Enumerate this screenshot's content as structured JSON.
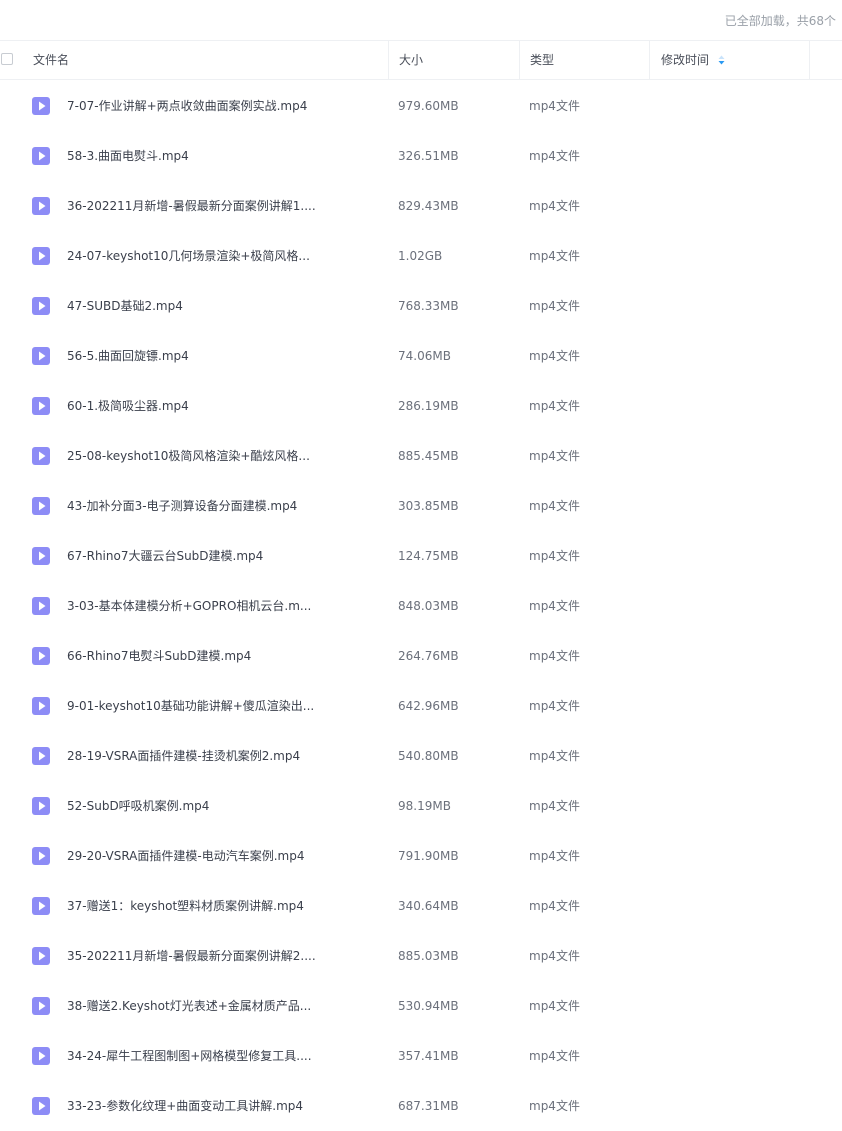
{
  "status": "已全部加载，共68个",
  "header": {
    "name": "文件名",
    "size": "大小",
    "type": "类型",
    "modified": "修改时间"
  },
  "colors": {
    "icon": "#8d8cf6",
    "sort": "#2b9af3"
  },
  "files": [
    {
      "name": "7-07-作业讲解+两点收敛曲面案例实战.mp4",
      "size": "979.60MB",
      "type": "mp4文件"
    },
    {
      "name": "58-3.曲面电熨斗.mp4",
      "size": "326.51MB",
      "type": "mp4文件"
    },
    {
      "name": "36-202211月新增-暑假最新分面案例讲解1....",
      "size": "829.43MB",
      "type": "mp4文件"
    },
    {
      "name": "24-07-keyshot10几何场景渲染+极简风格...",
      "size": "1.02GB",
      "type": "mp4文件"
    },
    {
      "name": "47-SUBD基础2.mp4",
      "size": "768.33MB",
      "type": "mp4文件"
    },
    {
      "name": "56-5.曲面回旋镖.mp4",
      "size": "74.06MB",
      "type": "mp4文件"
    },
    {
      "name": "60-1.极简吸尘器.mp4",
      "size": "286.19MB",
      "type": "mp4文件"
    },
    {
      "name": "25-08-keyshot10极简风格渲染+酷炫风格...",
      "size": "885.45MB",
      "type": "mp4文件"
    },
    {
      "name": "43-加补分面3-电子测算设备分面建模.mp4",
      "size": "303.85MB",
      "type": "mp4文件"
    },
    {
      "name": "67-Rhino7大疆云台SubD建模.mp4",
      "size": "124.75MB",
      "type": "mp4文件"
    },
    {
      "name": "3-03-基本体建模分析+GOPRO相机云台.m...",
      "size": "848.03MB",
      "type": "mp4文件"
    },
    {
      "name": "66-Rhino7电熨斗SubD建模.mp4",
      "size": "264.76MB",
      "type": "mp4文件"
    },
    {
      "name": "9-01-keyshot10基础功能讲解+傻瓜渲染出...",
      "size": "642.96MB",
      "type": "mp4文件"
    },
    {
      "name": "28-19-VSRA面插件建模-挂烫机案例2.mp4",
      "size": "540.80MB",
      "type": "mp4文件"
    },
    {
      "name": "52-SubD呼吸机案例.mp4",
      "size": "98.19MB",
      "type": "mp4文件"
    },
    {
      "name": "29-20-VSRA面插件建模-电动汽车案例.mp4",
      "size": "791.90MB",
      "type": "mp4文件"
    },
    {
      "name": "37-赠送1：keyshot塑料材质案例讲解.mp4",
      "size": "340.64MB",
      "type": "mp4文件"
    },
    {
      "name": "35-202211月新增-暑假最新分面案例讲解2....",
      "size": "885.03MB",
      "type": "mp4文件"
    },
    {
      "name": "38-赠送2.Keyshot灯光表述+金属材质产品...",
      "size": "530.94MB",
      "type": "mp4文件"
    },
    {
      "name": "34-24-犀牛工程图制图+网格模型修复工具....",
      "size": "357.41MB",
      "type": "mp4文件"
    },
    {
      "name": "33-23-参数化纹理+曲面变动工具讲解.mp4",
      "size": "687.31MB",
      "type": "mp4文件"
    }
  ]
}
